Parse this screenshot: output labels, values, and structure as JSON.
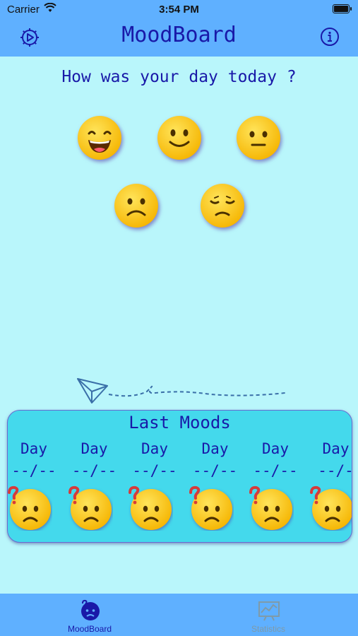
{
  "status_bar": {
    "carrier": "Carrier",
    "time": "3:54 PM"
  },
  "nav": {
    "title": "MoodBoard",
    "settings_icon": "gear-icon",
    "info_icon": "info-icon"
  },
  "question": "How was your day today ?",
  "mood_options": [
    {
      "name": "very-happy",
      "icon": "grinning-face-icon"
    },
    {
      "name": "happy",
      "icon": "smiling-face-icon"
    },
    {
      "name": "neutral",
      "icon": "neutral-face-icon"
    },
    {
      "name": "sad",
      "icon": "frowning-face-icon"
    },
    {
      "name": "very-sad",
      "icon": "pensive-face-icon"
    }
  ],
  "last_moods": {
    "title": "Last Moods",
    "days": [
      {
        "label": "Day",
        "date": "--/--",
        "icon": "confused-face-icon"
      },
      {
        "label": "Day",
        "date": "--/--",
        "icon": "confused-face-icon"
      },
      {
        "label": "Day",
        "date": "--/--",
        "icon": "confused-face-icon"
      },
      {
        "label": "Day",
        "date": "--/--",
        "icon": "confused-face-icon"
      },
      {
        "label": "Day",
        "date": "--/--",
        "icon": "confused-face-icon"
      },
      {
        "label": "Day",
        "date": "--/-",
        "icon": "confused-face-icon"
      }
    ]
  },
  "tabs": [
    {
      "label": "MoodBoard",
      "icon": "mood-face-icon",
      "active": true
    },
    {
      "label": "Statistics",
      "icon": "chart-icon",
      "active": false
    }
  ],
  "colors": {
    "bar": "#5fb0ff",
    "background": "#b9f6fb",
    "card": "#44d9ec",
    "text": "#1919a8"
  }
}
